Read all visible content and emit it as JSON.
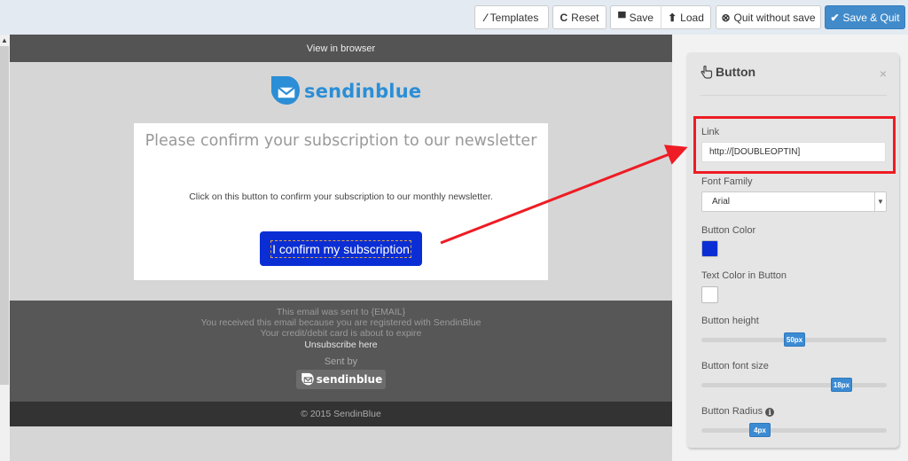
{
  "toolbar": {
    "templates": {
      "icon": "magic-wand-icon",
      "glyph": "⁄",
      "label": "Templates"
    },
    "reset": {
      "icon": "refresh-icon",
      "glyph": "C",
      "label": "Reset"
    },
    "save": {
      "icon": "floppy-disk-icon",
      "glyph": "▀",
      "label": "Save"
    },
    "load": {
      "icon": "upload-icon",
      "glyph": "⬆",
      "label": "Load"
    },
    "quit": {
      "icon": "circle-x-icon",
      "glyph": "⊗",
      "label": "Quit without save"
    },
    "save_quit": {
      "icon": "checkmark-icon",
      "glyph": "✔",
      "label": "Save & Quit"
    }
  },
  "email": {
    "view_in_browser": "View in browser",
    "brand": "sendinblue",
    "title": "Please confirm your subscription to our newsletter",
    "body": "Click on this button to confirm your subscription to our monthly newsletter.",
    "button_label": "I confirm my subscription",
    "footer": {
      "lines": [
        "This email was sent to {EMAIL}",
        "You received this email because you are registered with SendinBlue",
        "Your credit/debit card is about to expire"
      ],
      "unsubscribe": "Unsubscribe here",
      "sent_by": "Sent by",
      "brand": "sendinblue"
    },
    "copyright": "© 2015 SendinBlue"
  },
  "panel": {
    "title": "Button",
    "close": "×",
    "link_label": "Link",
    "link_value": "http://[DOUBLEOPTIN]",
    "font_family_label": "Font Family",
    "font_family_value": "Arial",
    "button_color_label": "Button Color",
    "button_color": "#0b2ed4",
    "text_color_label": "Text Color in Button",
    "text_color": "#ffffff",
    "height_label": "Button height",
    "height_value": "50px",
    "height_fraction": 0.5,
    "font_size_label": "Button font size",
    "font_size_value": "18px",
    "font_size_fraction": 0.79,
    "radius_label": "Button Radius",
    "radius_value": "4px",
    "radius_fraction": 0.29
  },
  "colors": {
    "primary": "#428bca",
    "brand_blue": "#2b8ed6",
    "annotation_red": "#ee1c24"
  }
}
